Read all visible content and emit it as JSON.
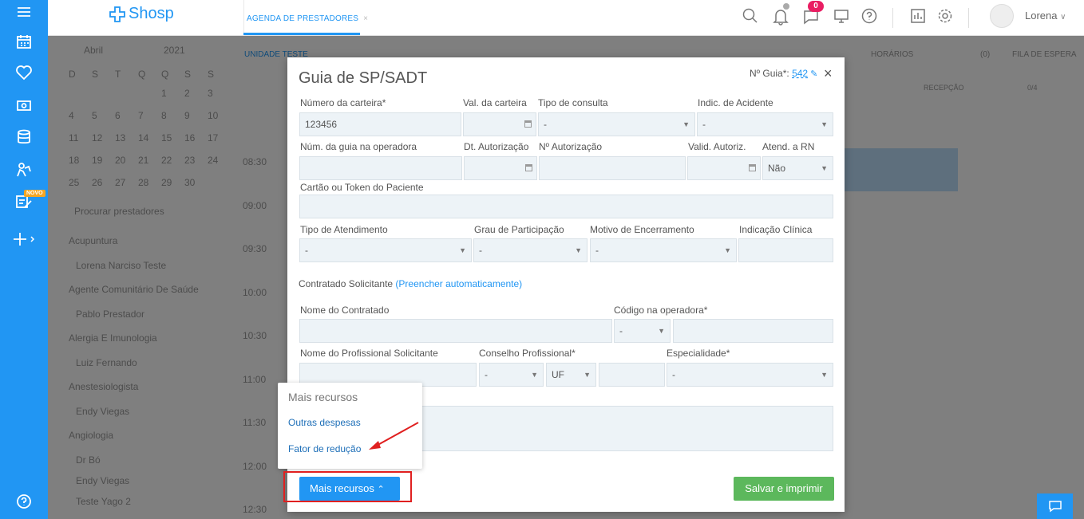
{
  "app": {
    "brand": "Shosp",
    "user": "Lorena",
    "notif_count": "0",
    "new_badge": "NOVO"
  },
  "tabs": [
    {
      "label": "AGENDA DE PRESTADORES"
    }
  ],
  "background": {
    "month": "Abril",
    "year": "2021",
    "weekdays": [
      "D",
      "S",
      "T",
      "Q",
      "Q",
      "S",
      "S"
    ],
    "weeks": [
      [
        "",
        "",
        "",
        "",
        "1",
        "2",
        "3"
      ],
      [
        "4",
        "5",
        "6",
        "7",
        "8",
        "9",
        "10"
      ],
      [
        "11",
        "12",
        "13",
        "14",
        "15",
        "16",
        "17"
      ],
      [
        "18",
        "19",
        "20",
        "21",
        "22",
        "23",
        "24"
      ],
      [
        "25",
        "26",
        "27",
        "28",
        "29",
        "30",
        ""
      ]
    ],
    "search_placeholder": "Procurar prestadores",
    "specialties": [
      {
        "name": "Acupuntura",
        "providers": [
          "Lorena Narciso Teste"
        ]
      },
      {
        "name": "Agente Comunitário De Saúde",
        "providers": [
          "Pablo Prestador"
        ]
      },
      {
        "name": "Alergia E Imunologia",
        "providers": [
          "Luiz Fernando"
        ]
      },
      {
        "name": "Anestesiologista",
        "providers": [
          "Endy Viegas"
        ]
      },
      {
        "name": "Angiologia",
        "providers": [
          "Dr Bó",
          "Endy Viegas",
          "Teste Yago 2"
        ]
      }
    ],
    "unit_label": "UNIDADE TESTE",
    "times": [
      "08:30",
      "09:00",
      "09:30",
      "10:00",
      "10:30",
      "11:00",
      "11:30",
      "12:00",
      "12:30"
    ],
    "top_links": [
      "HORÁRIOS",
      "(0)",
      "FILA DE ESPERA"
    ],
    "reception_label": "RECEPÇÃO",
    "day_label": "0/4"
  },
  "modal": {
    "title": "Guia de SP/SADT",
    "guia_label": "Nº Guia*:",
    "guia_number": "542",
    "fields": {
      "numero_carteira": {
        "label": "Número da carteira*",
        "value": "123456"
      },
      "val_carteira": {
        "label": "Val. da carteira",
        "value": ""
      },
      "tipo_consulta": {
        "label": "Tipo de consulta",
        "value": "-"
      },
      "indic_acidente": {
        "label": "Indic. de Acidente",
        "value": "-"
      },
      "num_guia_operadora": {
        "label": "Núm. da guia na operadora",
        "value": ""
      },
      "dt_autorizacao": {
        "label": "Dt. Autorização",
        "value": ""
      },
      "n_autorizacao": {
        "label": "Nº Autorização",
        "value": ""
      },
      "valid_autoriz": {
        "label": "Valid. Autoriz.",
        "value": ""
      },
      "atend_rn": {
        "label": "Atend. a RN",
        "value": "Não"
      },
      "cartao_token": {
        "label": "Cartão ou Token do Paciente",
        "value": ""
      },
      "tipo_atendimento": {
        "label": "Tipo de Atendimento",
        "value": "-"
      },
      "grau_participacao": {
        "label": "Grau de Participação",
        "value": "-"
      },
      "motivo_encerramento": {
        "label": "Motivo de Encerramento",
        "value": "-"
      },
      "indicacao_clinica": {
        "label": "Indicação Clínica",
        "value": ""
      },
      "nome_contratado": {
        "label": "Nome do Contratado",
        "value": ""
      },
      "codigo_operadora": {
        "label": "Código na operadora*",
        "select_value": "-",
        "value": ""
      },
      "nome_profissional": {
        "label": "Nome do Profissional Solicitante",
        "value": ""
      },
      "conselho": {
        "label": "Conselho Profissional*",
        "select_value": "-",
        "uf_value": "UF",
        "value": ""
      },
      "especialidade": {
        "label": "Especialidade*",
        "value": "-"
      },
      "observacao": {
        "value": ""
      }
    },
    "contratado_section": "Contratado Solicitante",
    "autofill_link": "(Preencher automaticamente)",
    "save_button": "Salvar e imprimir",
    "more_button": "Mais recursos"
  },
  "dropdown": {
    "header": "Mais recursos",
    "items": [
      "Outras despesas",
      "Fator de redução"
    ]
  },
  "colors": {
    "primary": "#2196f3",
    "success": "#5cb85c",
    "highlight": "#e02020",
    "badge": "#e91e63"
  }
}
